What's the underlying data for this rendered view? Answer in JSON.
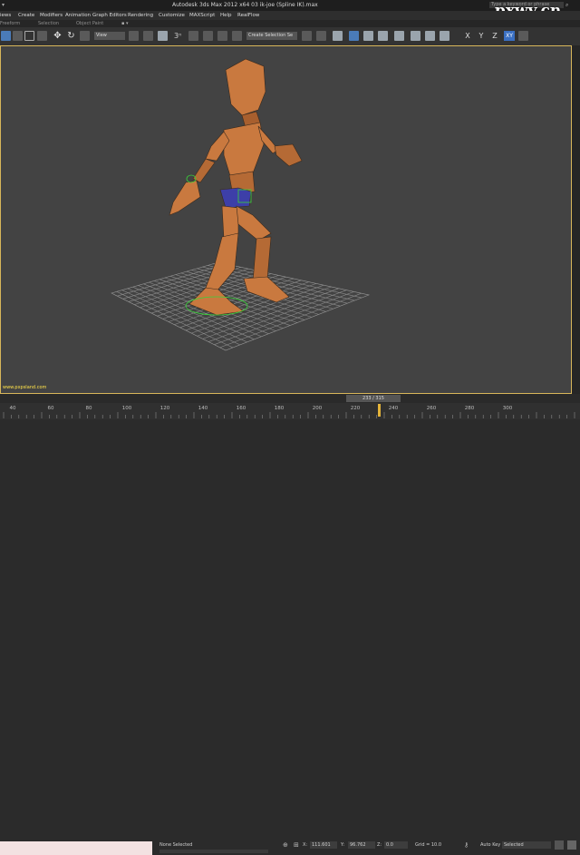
{
  "app": {
    "title": "Autodesk 3ds Max  2012 x64     03 ik-joe (Spline IK).max",
    "search_placeholder": "Type a keyword or phrase",
    "watermark": "pxwy.cn"
  },
  "menu": [
    "iews",
    "Create",
    "Modifiers",
    "Animation",
    "Graph Editors",
    "Rendering",
    "Customize",
    "MAXScript",
    "Help",
    "RealFlow"
  ],
  "ribbon_labels": [
    "Freeform",
    "Selection",
    "Object Paint"
  ],
  "toolbar": {
    "filter_value": "View",
    "selection_set_placeholder": "Create Selection Se",
    "axes": [
      "X",
      "Y",
      "Z",
      "XY"
    ]
  },
  "viewport": {
    "caption": "www.pxpsland.com"
  },
  "timeline": {
    "frame": "233 / 315",
    "ticks": [
      "40",
      "60",
      "80",
      "100",
      "120",
      "140",
      "160",
      "180",
      "200",
      "220",
      "240",
      "260",
      "280",
      "300"
    ]
  },
  "status": {
    "selection": "None Selected",
    "x_value": "111.601",
    "y_value": "96.762",
    "z_value": "0.0",
    "grid": "Grid = 10.0",
    "auto_key": "Auto Key",
    "key_mode": "Selected"
  },
  "colors": {
    "viewport_border": "#d8b65a",
    "character_skin": "#c9793f",
    "active_axis": "#3a6fc2"
  }
}
